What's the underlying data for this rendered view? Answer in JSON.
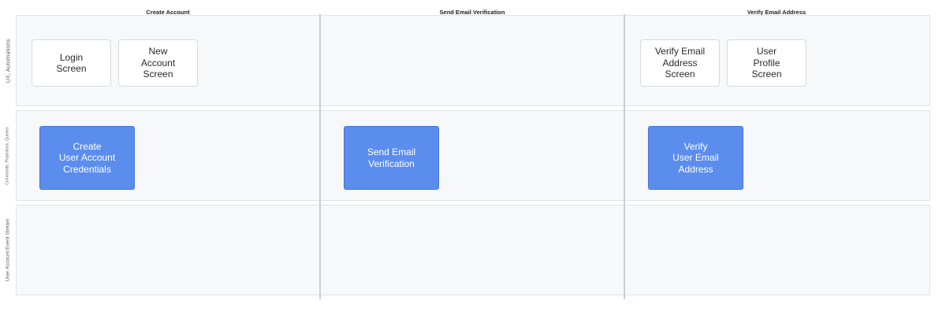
{
  "columns": [
    {
      "title": "Create Account"
    },
    {
      "title": "Send Email Verification"
    },
    {
      "title": "Verify Email Address"
    }
  ],
  "lanes": [
    {
      "label": "UX, Automations"
    },
    {
      "label": "Commands, Projections, Queries"
    },
    {
      "label": "User Account Event Stream"
    }
  ],
  "ux_cards": [
    {
      "text": "Login\nScreen"
    },
    {
      "text": "New\nAccount\nScreen"
    },
    {
      "text": "Verify Email\nAddress\nScreen"
    },
    {
      "text": "User\nProfile\nScreen"
    }
  ],
  "command_cards": [
    {
      "text": "Create\nUser Account\nCredentials"
    },
    {
      "text": "Send Email\nVerification"
    },
    {
      "text": "Verify\nUser Email\nAddress"
    }
  ],
  "colors": {
    "lane_background": "#f7f8fa",
    "lane_border": "#dfe3ea",
    "divider": "#c9ced6",
    "command_card": "#5b8def",
    "ux_card": "#ffffff"
  }
}
